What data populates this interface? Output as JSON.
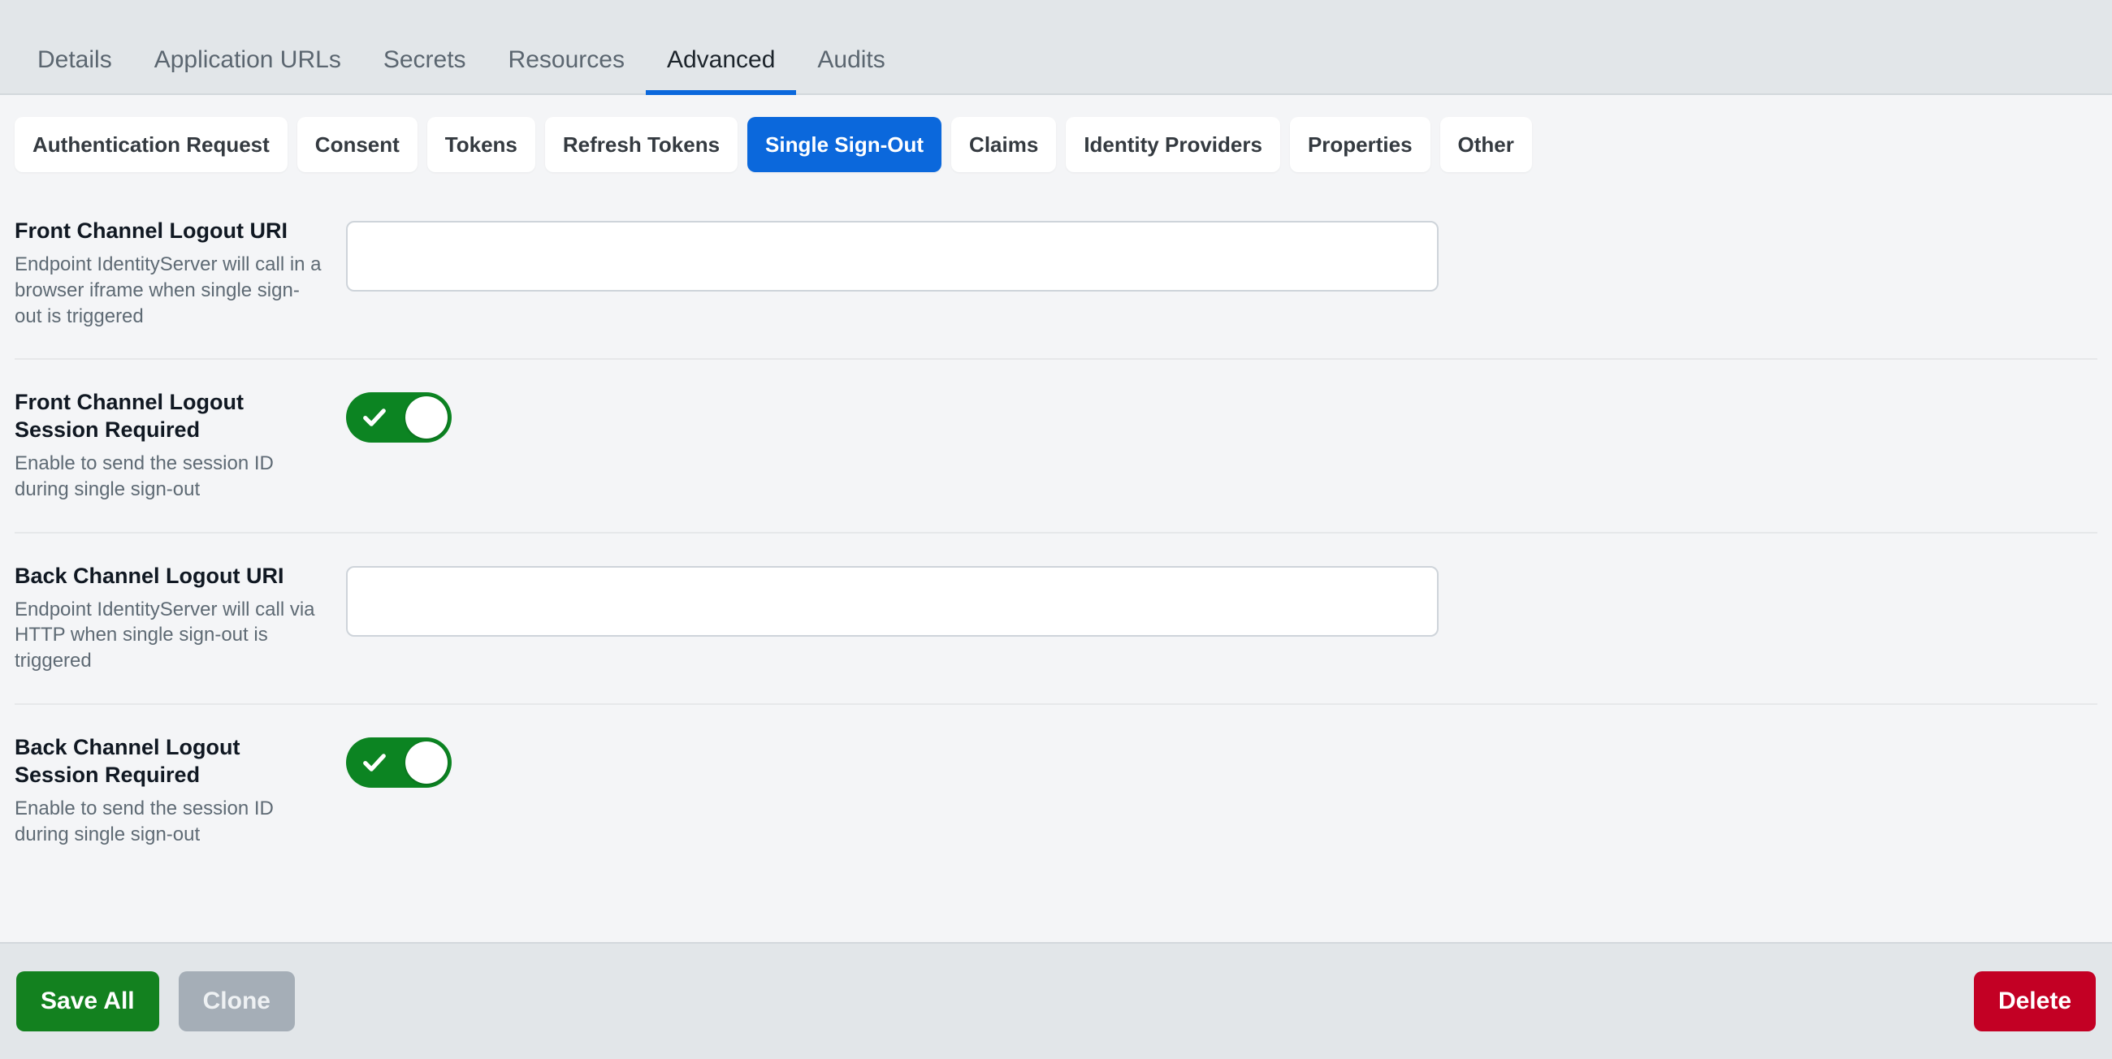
{
  "main_tabs": [
    {
      "label": "Details",
      "active": false
    },
    {
      "label": "Application URLs",
      "active": false
    },
    {
      "label": "Secrets",
      "active": false
    },
    {
      "label": "Resources",
      "active": false
    },
    {
      "label": "Advanced",
      "active": true
    },
    {
      "label": "Audits",
      "active": false
    }
  ],
  "sub_tabs": [
    {
      "label": "Authentication Request",
      "active": false
    },
    {
      "label": "Consent",
      "active": false
    },
    {
      "label": "Tokens",
      "active": false
    },
    {
      "label": "Refresh Tokens",
      "active": false
    },
    {
      "label": "Single Sign-Out",
      "active": true
    },
    {
      "label": "Claims",
      "active": false
    },
    {
      "label": "Identity Providers",
      "active": false
    },
    {
      "label": "Properties",
      "active": false
    },
    {
      "label": "Other",
      "active": false
    }
  ],
  "rows": [
    {
      "title": "Front Channel Logout URI",
      "description": "Endpoint IdentityServer will call in a browser iframe when single sign-out is triggered",
      "control": "text",
      "value": "",
      "placeholder": ""
    },
    {
      "title": "Front Channel Logout Session Required",
      "description": "Enable to send the session ID during single sign-out",
      "control": "toggle",
      "value": "on"
    },
    {
      "title": "Back Channel Logout URI",
      "description": "Endpoint IdentityServer will call via HTTP when single sign-out is triggered",
      "control": "text",
      "value": "",
      "placeholder": ""
    },
    {
      "title": "Back Channel Logout Session Required",
      "description": "Enable to send the session ID during single sign-out",
      "control": "toggle",
      "value": "on"
    }
  ],
  "footer": {
    "save_label": "Save All",
    "clone_label": "Clone",
    "delete_label": "Delete"
  },
  "colors": {
    "accent_blue": "#0b68dc",
    "toggle_green": "#0c8422",
    "save_green": "#13811f",
    "clone_gray": "#a5aeb7",
    "delete_red": "#c30024",
    "header_bg": "#e2e6e9",
    "page_bg": "#f4f5f7"
  }
}
